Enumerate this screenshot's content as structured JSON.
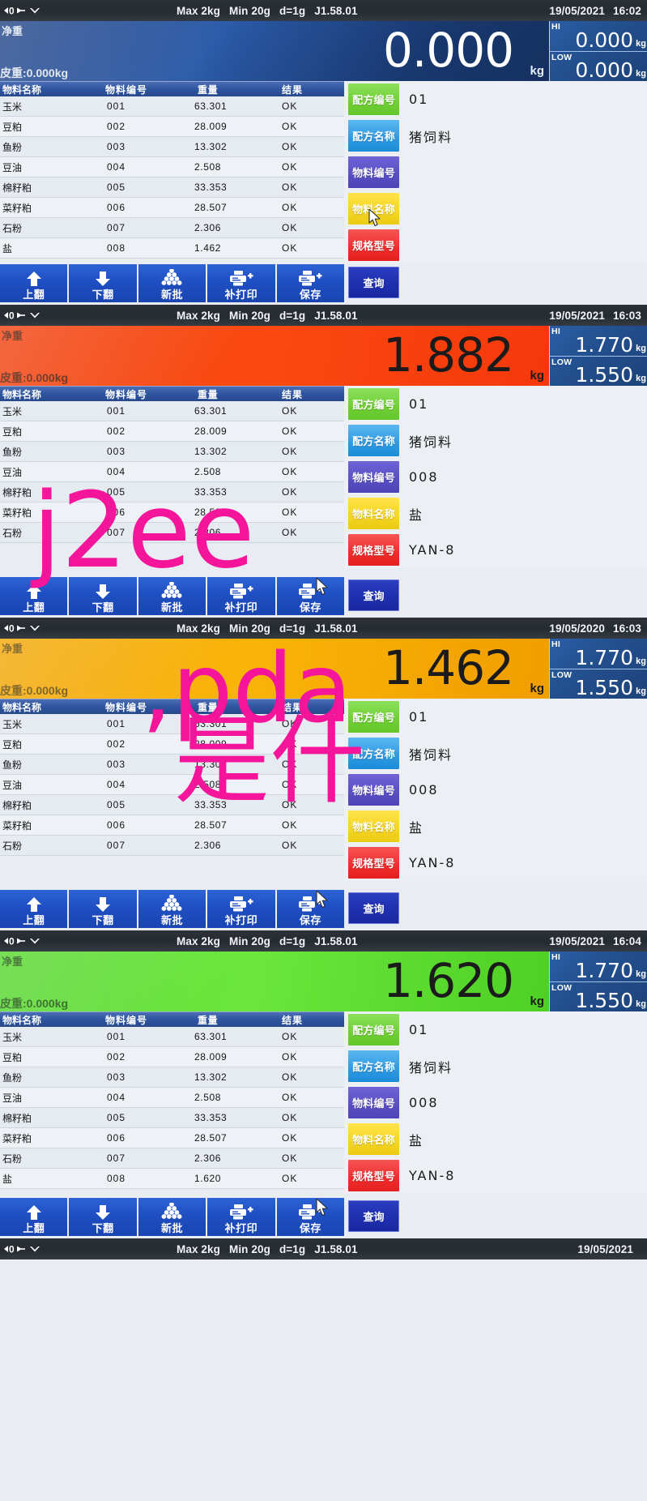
{
  "device": {
    "spec_max": "Max 2kg",
    "spec_min": "Min 20g",
    "spec_d": "d=1g",
    "firmware": "J1.58.01",
    "icon_zero": "zero-icon",
    "icon_stable": "stability-icon",
    "net_label": "净重",
    "unit": "kg",
    "hi_label": "HI",
    "low_label": "LOW"
  },
  "table": {
    "headers": [
      "物料名称",
      "物料编号",
      "重量",
      "结果"
    ],
    "rows": [
      {
        "name": "玉米",
        "code": "001",
        "weight": "63.301",
        "result": "OK"
      },
      {
        "name": "豆粕",
        "code": "002",
        "weight": "28.009",
        "result": "OK"
      },
      {
        "name": "鱼粉",
        "code": "003",
        "weight": "13.302",
        "result": "OK"
      },
      {
        "name": "豆油",
        "code": "004",
        "weight": "2.508",
        "result": "OK"
      },
      {
        "name": "棉籽粕",
        "code": "005",
        "weight": "33.353",
        "result": "OK"
      },
      {
        "name": "菜籽粕",
        "code": "006",
        "weight": "28.507",
        "result": "OK"
      },
      {
        "name": "石粉",
        "code": "007",
        "weight": "2.306",
        "result": "OK"
      },
      {
        "name": "盐",
        "code": "008",
        "weight": "1.462",
        "result": "OK"
      }
    ]
  },
  "info_labels": {
    "formula_no": "配方编号",
    "formula_name": "配方名称",
    "material_no": "物料编号",
    "material_name": "物料名称",
    "spec_model": "规格型号",
    "query": "查询"
  },
  "toolbar": {
    "page_up": "上翻",
    "page_down": "下翻",
    "new_batch": "新批",
    "reprint": "补打印",
    "save": "保存"
  },
  "colors": {
    "chip_formula_no": "#6fd033",
    "chip_formula_name": "#2e9ae4",
    "chip_material_no": "#5a4ec6",
    "chip_material_name": "#f5d423",
    "chip_spec_model": "#ef2d2d",
    "query_button": "#1f2fae",
    "toolbar_button": "#1f4fc2",
    "weight_blue": "#2a5aa8",
    "weight_red": "#fa4a10",
    "weight_amber": "#f9b408",
    "weight_green": "#6ce63c"
  },
  "panels": [
    {
      "date": "19/05/2021",
      "time": "16:02",
      "weight": "0.000",
      "tare": "皮重:0.000kg",
      "hi": "0.000",
      "low": "0.000",
      "info": {
        "formula_no": "01",
        "formula_name": "猪饲料",
        "material_no": "",
        "material_name": "",
        "spec_model": ""
      },
      "rows_end": 8,
      "highlight_row": 0,
      "last_weight": "1.462"
    },
    {
      "date": "19/05/2021",
      "time": "16:03",
      "weight": "1.882",
      "tare": "皮重:0.000kg",
      "hi": "1.770",
      "low": "1.550",
      "info": {
        "formula_no": "01",
        "formula_name": "猪饲料",
        "material_no": "008",
        "material_name": "盐",
        "spec_model": "YAN-8"
      },
      "rows_end": 7,
      "highlight_row": 0,
      "last_weight": "2.306"
    },
    {
      "date": "19/05/2020",
      "time": "16:03",
      "weight": "1.462",
      "tare": "皮重:0.000kg",
      "hi": "1.770",
      "low": "1.550",
      "info": {
        "formula_no": "01",
        "formula_name": "猪饲料",
        "material_no": "008",
        "material_name": "盐",
        "spec_model": "YAN-8"
      },
      "rows_end": 7,
      "highlight_row": 0,
      "last_weight": "2.306"
    },
    {
      "date": "19/05/2021",
      "time": "16:04",
      "weight": "1.620",
      "tare": "皮重:0.000kg",
      "hi": "1.770",
      "low": "1.550",
      "info": {
        "formula_no": "01",
        "formula_name": "猪饲料",
        "material_no": "008",
        "material_name": "盐",
        "spec_model": "YAN-8"
      },
      "rows_end": 8,
      "highlight_row": 0,
      "last_weight": "1.620"
    },
    {
      "date": "19/05/2021",
      "time": "",
      "weight": "",
      "tare": "",
      "hi": "",
      "low": "",
      "info": {
        "formula_no": "",
        "formula_name": "",
        "material_no": "",
        "material_name": "",
        "spec_model": ""
      },
      "rows_end": 0,
      "highlight_row": 0,
      "last_weight": ""
    }
  ],
  "watermark": {
    "line1": "j2ee",
    "line2": ",pda",
    "line3": "是什"
  }
}
